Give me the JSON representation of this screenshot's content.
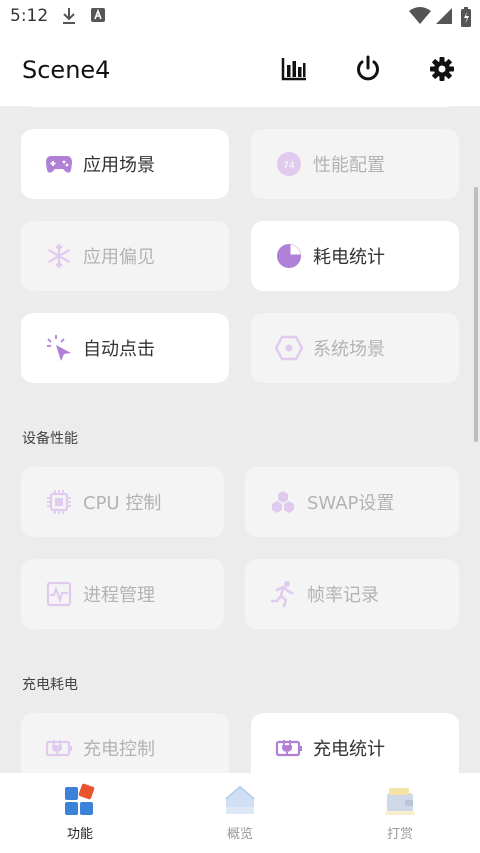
{
  "status": {
    "time": "5:12"
  },
  "app": {
    "title": "Scene4",
    "actions": [
      "bar-chart-icon",
      "power-icon",
      "gear-icon"
    ]
  },
  "colors": {
    "accent": "#b07fd6",
    "accent_dim": "#e0cbee"
  },
  "cards": [
    {
      "label": "应用场景",
      "icon": "gamepad-icon",
      "active": true
    },
    {
      "label": "性能配置",
      "icon": "gauge-icon",
      "active": false
    },
    {
      "label": "应用偏见",
      "icon": "snowflake-icon",
      "active": false
    },
    {
      "label": "耗电统计",
      "icon": "pie-chart-icon",
      "active": true
    },
    {
      "label": "自动点击",
      "icon": "cursor-click-icon",
      "active": true
    },
    {
      "label": "系统场景",
      "icon": "hexagon-icon",
      "active": false
    }
  ],
  "sections": [
    {
      "title": "设备性能",
      "items": [
        {
          "label": "CPU 控制",
          "icon": "cpu-icon",
          "active": false
        },
        {
          "label": "SWAP设置",
          "icon": "hexagons-icon",
          "active": false
        },
        {
          "label": "进程管理",
          "icon": "pulse-icon",
          "active": false
        },
        {
          "label": "帧率记录",
          "icon": "runner-icon",
          "active": false
        }
      ]
    },
    {
      "title": "充电耗电",
      "items": [
        {
          "label": "充电控制",
          "icon": "battery-charge-icon",
          "active": false
        },
        {
          "label": "充电统计",
          "icon": "battery-stats-icon",
          "active": true
        }
      ]
    }
  ],
  "nav": [
    {
      "label": "功能",
      "icon": "apps-icon",
      "active": true
    },
    {
      "label": "概览",
      "icon": "home-icon",
      "active": false
    },
    {
      "label": "打赏",
      "icon": "wallet-icon",
      "active": false
    }
  ]
}
